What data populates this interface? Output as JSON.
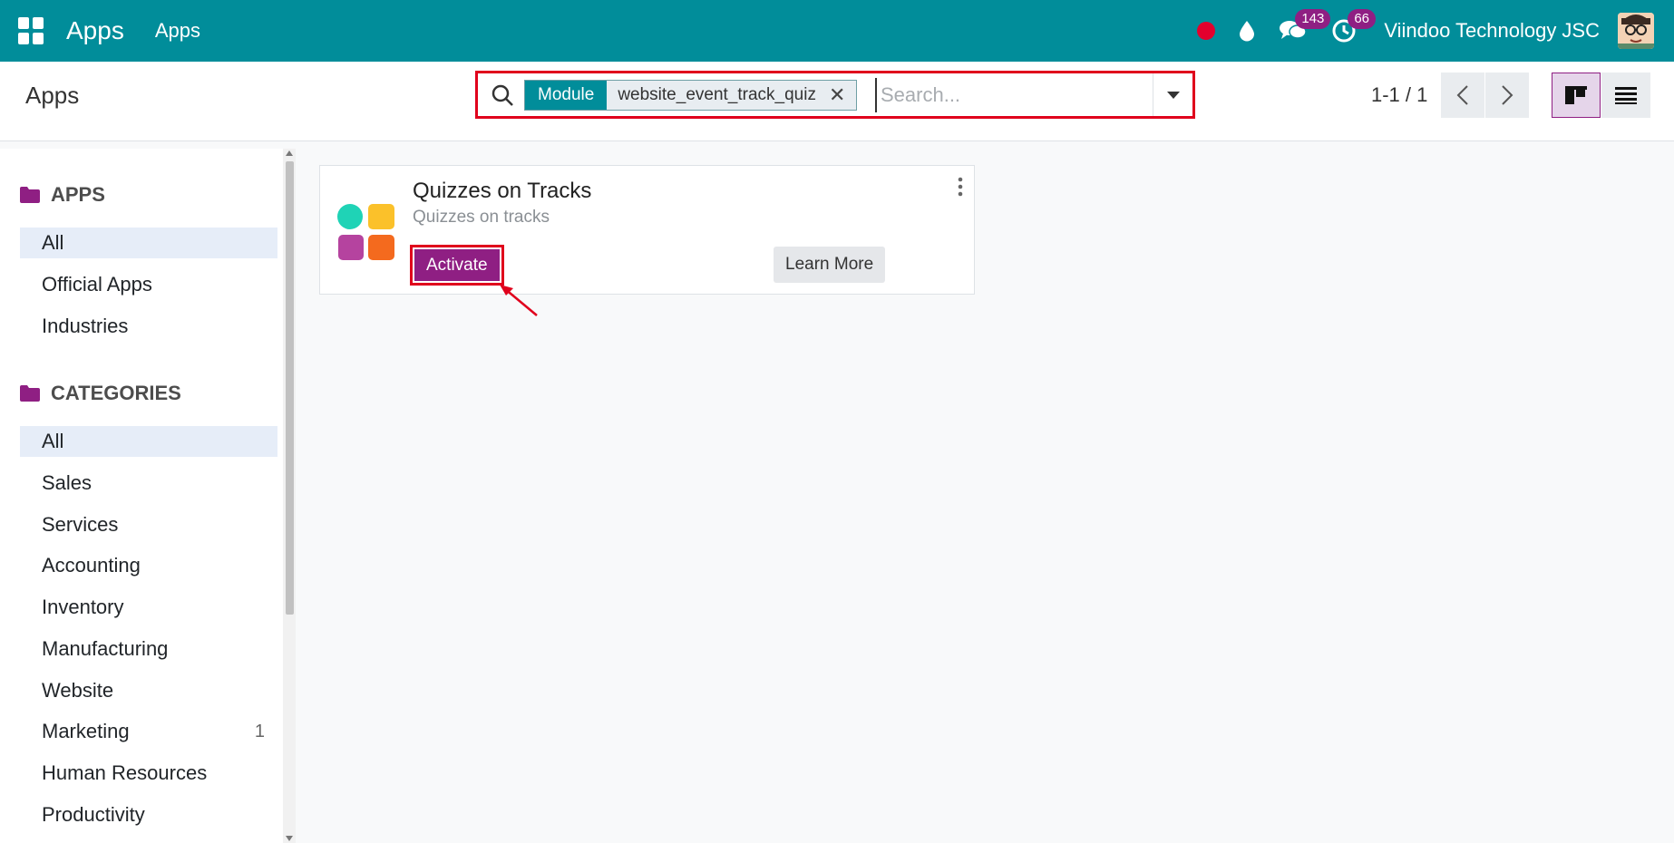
{
  "navbar": {
    "brand": "Apps",
    "menu_item": "Apps",
    "messages_count": "143",
    "activities_count": "66",
    "company": "Viindoo Technology JSC"
  },
  "control_panel": {
    "title": "Apps",
    "search": {
      "facet_label": "Module",
      "facet_value": "website_event_track_quiz",
      "placeholder": "Search..."
    },
    "pager": "1-1 / 1"
  },
  "sidebar": {
    "apps_header": "APPS",
    "apps_items": [
      {
        "label": "All",
        "active": true
      },
      {
        "label": "Official Apps"
      },
      {
        "label": "Industries"
      }
    ],
    "categories_header": "CATEGORIES",
    "category_items": [
      {
        "label": "All",
        "active": true
      },
      {
        "label": "Sales"
      },
      {
        "label": "Services"
      },
      {
        "label": "Accounting"
      },
      {
        "label": "Inventory"
      },
      {
        "label": "Manufacturing"
      },
      {
        "label": "Website"
      },
      {
        "label": "Marketing",
        "count": "1"
      },
      {
        "label": "Human Resources"
      },
      {
        "label": "Productivity"
      }
    ]
  },
  "card": {
    "title": "Quizzes on Tracks",
    "subtitle": "Quizzes on tracks",
    "activate_label": "Activate",
    "learn_more_label": "Learn More"
  },
  "colors": {
    "navbar": "#018d9a",
    "primary": "#8f1f83",
    "highlight": "#e0001c"
  }
}
